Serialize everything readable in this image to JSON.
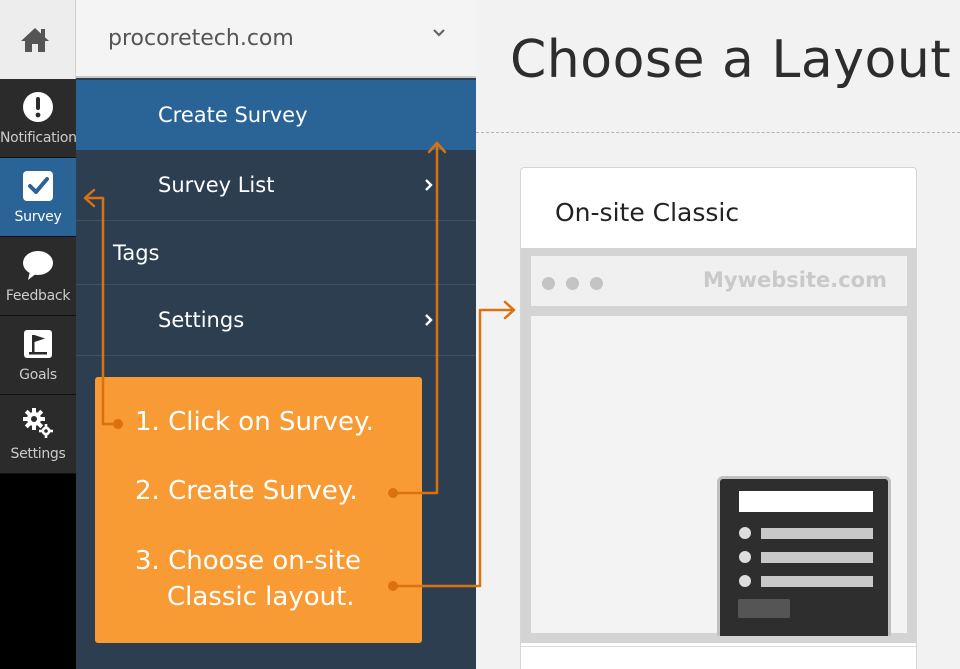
{
  "colors": {
    "accent_blue": "#2a6496",
    "menu_bg": "#2c3e50",
    "callout_orange": "#f89b35",
    "arrow_orange": "#d9720f"
  },
  "rail": {
    "home_icon": "home-icon",
    "items": [
      {
        "label": "Notification",
        "icon": "exclamation-circle-icon"
      },
      {
        "label": "Survey",
        "icon": "checkbox-icon",
        "active": true
      },
      {
        "label": "Feedback",
        "icon": "speech-bubble-icon"
      },
      {
        "label": "Goals",
        "icon": "flag-icon"
      },
      {
        "label": "Settings",
        "icon": "gears-icon"
      }
    ]
  },
  "site_selector": {
    "value": "procoretech.com",
    "icon": "chevron-down-icon"
  },
  "menu": {
    "items": [
      {
        "label": "Create Survey",
        "active": true
      },
      {
        "label": "Survey List",
        "icon": "chevron-right-icon"
      },
      {
        "label": "Tags"
      },
      {
        "label": "Settings",
        "icon": "chevron-right-icon"
      }
    ]
  },
  "callout": {
    "steps": [
      {
        "line1": "1. Click on Survey."
      },
      {
        "line1": "2. Create Survey."
      },
      {
        "line1": "3. Choose on-site",
        "line2": "Classic layout."
      }
    ]
  },
  "main": {
    "title": "Choose a Layout",
    "card": {
      "title": "On-site Classic",
      "browser_url": "Mywebsite.com"
    }
  }
}
